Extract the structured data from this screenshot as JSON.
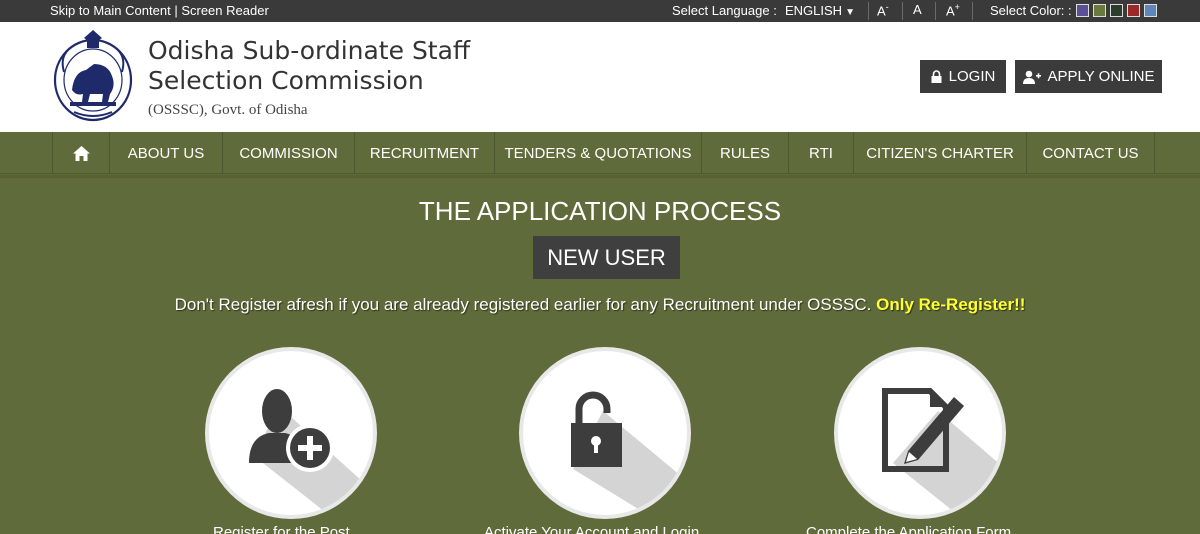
{
  "topbar": {
    "skip_link": "Skip to Main Content",
    "divider": "|",
    "screen_reader": "Screen Reader",
    "language_label": "Select Language :",
    "language_value": "ENGLISH",
    "font_decrease": "A",
    "font_normal": "A",
    "font_increase": "A",
    "color_label": "Select Color: :",
    "swatches": [
      "#5b4f96",
      "#6b7a3c",
      "#2b3d2c",
      "#9a2a2a",
      "#5f86b8"
    ]
  },
  "header": {
    "title_line1": "Odisha Sub-ordinate Staff",
    "title_line2": "Selection Commission",
    "subtitle": "(OSSSC), Govt. of Odisha",
    "login_label": "LOGIN",
    "apply_label": "APPLY ONLINE"
  },
  "nav": {
    "items": [
      "ABOUT US",
      "COMMISSION",
      "RECRUITMENT",
      "TENDERS & QUOTATIONS",
      "RULES",
      "RTI",
      "CITIZEN'S CHARTER",
      "CONTACT US"
    ]
  },
  "content": {
    "title": "THE APPLICATION PROCESS",
    "new_user": "NEW USER",
    "notice_main": "Don't Register afresh if you are already registered earlier for any Recruitment under OSSSC.",
    "notice_highlight": "Only Re-Register!!",
    "steps": [
      {
        "label": "Register for the Post",
        "icon": "user-add-icon"
      },
      {
        "label": "Activate Your Account and Login",
        "icon": "unlock-icon"
      },
      {
        "label": "Complete the Application Form",
        "icon": "edit-form-icon"
      }
    ]
  },
  "colors": {
    "olive": "#5f6b3a",
    "dark": "#3a3a3a",
    "highlight": "#ffff33"
  }
}
